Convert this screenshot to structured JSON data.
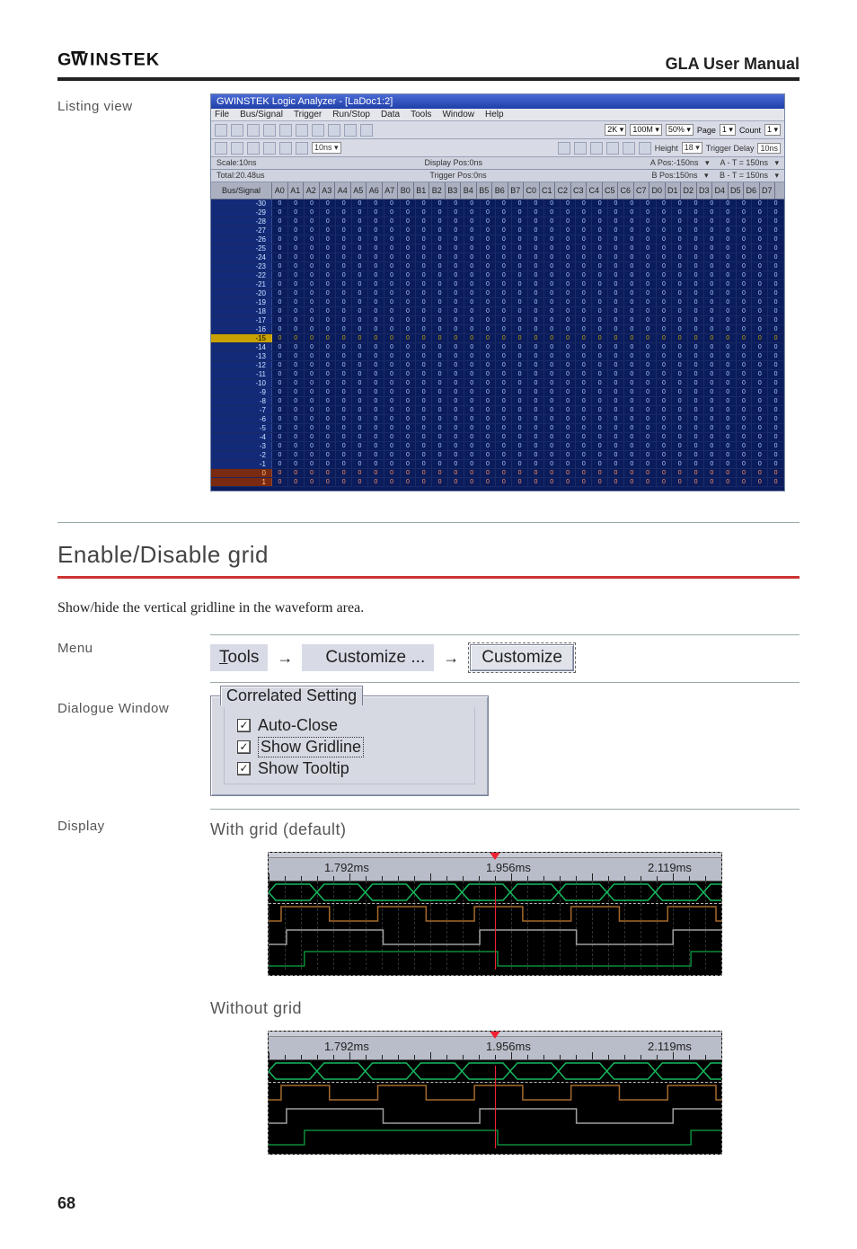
{
  "brand_text": "GWINSTEK",
  "manual_title": "GLA User Manual",
  "listing": {
    "label": "Listing view",
    "titlebar": "GWINSTEK Logic Analyzer - [LaDoc1:2]",
    "menubar": [
      "File",
      "Bus/Signal",
      "Trigger",
      "Run/Stop",
      "Data",
      "Tools",
      "Window",
      "Help"
    ],
    "toolbar2_text": "10ns",
    "toolbar_right": {
      "rate": "2K",
      "rate2": "100M",
      "zoom_lbl": "50%",
      "page_lbl": "Page",
      "page_val": "1",
      "count_lbl": "Count",
      "count_val": "1",
      "height_lbl": "Height",
      "height_val": "18",
      "trg_delay_lbl": "Trigger Delay",
      "trg_delay_val": "10ns"
    },
    "info_left_scale": "Scale:10ns",
    "info_left_total": "Total:20.48us",
    "info_mid_disp": "Display Pos:0ns",
    "info_mid_trg": "Trigger Pos:0ns",
    "info_right_a": "A Pos:-150ns",
    "info_right_b": "B Pos:150ns",
    "info_right_at": "A - T = 150ns",
    "info_right_bt": "B - T = 150ns",
    "bus_signal_hdr": "Bus/Signal",
    "cols": [
      "A0",
      "A1",
      "A2",
      "A3",
      "A4",
      "A5",
      "A6",
      "A7",
      "B0",
      "B1",
      "B2",
      "B3",
      "B4",
      "B5",
      "B6",
      "B7",
      "C0",
      "C1",
      "C2",
      "C3",
      "C4",
      "C5",
      "C6",
      "C7",
      "D0",
      "D1",
      "D2",
      "D3",
      "D4",
      "D5",
      "D6",
      "D7"
    ],
    "rows": [
      -30,
      -29,
      -28,
      -27,
      -26,
      -25,
      -24,
      -23,
      -22,
      -21,
      -20,
      -19,
      -18,
      -17,
      -16,
      -15,
      -14,
      -13,
      -12,
      -11,
      -10,
      -9,
      -8,
      -7,
      -6,
      -5,
      -4,
      -3,
      -2,
      -1,
      0,
      1
    ]
  },
  "grid_section": {
    "heading": "Enable/Disable grid",
    "desc": "Show/hide the vertical gridline in the waveform area.",
    "menu_label": "Menu",
    "menu_tools_display": "Tools",
    "menu_tools_underline_prefix": "T",
    "menu_tools_underline_rest": "ools",
    "menu_customize": "Customize ...",
    "tab_customize": "Customize",
    "dlg_label": "Dialogue Window",
    "groupbox_legend": "Correlated Setting",
    "chk1": "Auto-Close",
    "chk2": "Show Gridline",
    "chk3": "Show Tooltip",
    "display_label": "Display",
    "caption_with": "With grid (default)",
    "caption_without": "Without grid",
    "time_labels": [
      "1.792ms",
      "1.956ms",
      "2.119ms"
    ]
  },
  "page_number": "68"
}
